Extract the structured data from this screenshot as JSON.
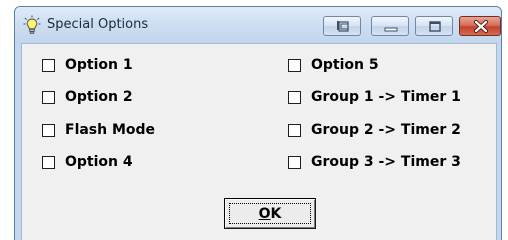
{
  "window": {
    "title": "Special Options",
    "icon": "lightbulb-icon",
    "buttons": {
      "restore": "restore-icon",
      "minimize": "minimize-icon",
      "maximize": "maximize-icon",
      "close": "close-icon"
    }
  },
  "options": {
    "left": [
      {
        "label": "Option 1",
        "checked": false
      },
      {
        "label": "Option 2",
        "checked": false
      },
      {
        "label": "Flash Mode",
        "checked": false
      },
      {
        "label": "Option 4",
        "checked": false
      }
    ],
    "right": [
      {
        "label": "Option 5",
        "checked": false
      },
      {
        "label": "Group 1 -> Timer 1",
        "checked": false
      },
      {
        "label": "Group 2 -> Timer 2",
        "checked": false
      },
      {
        "label": "Group 3 -> Timer 3",
        "checked": false
      }
    ]
  },
  "ok_button": {
    "mnemonic": "O",
    "rest": "K"
  },
  "colors": {
    "titlebar": "#cfdff2",
    "close_button": "#c3432c",
    "client_background": "#f0f0f0"
  }
}
